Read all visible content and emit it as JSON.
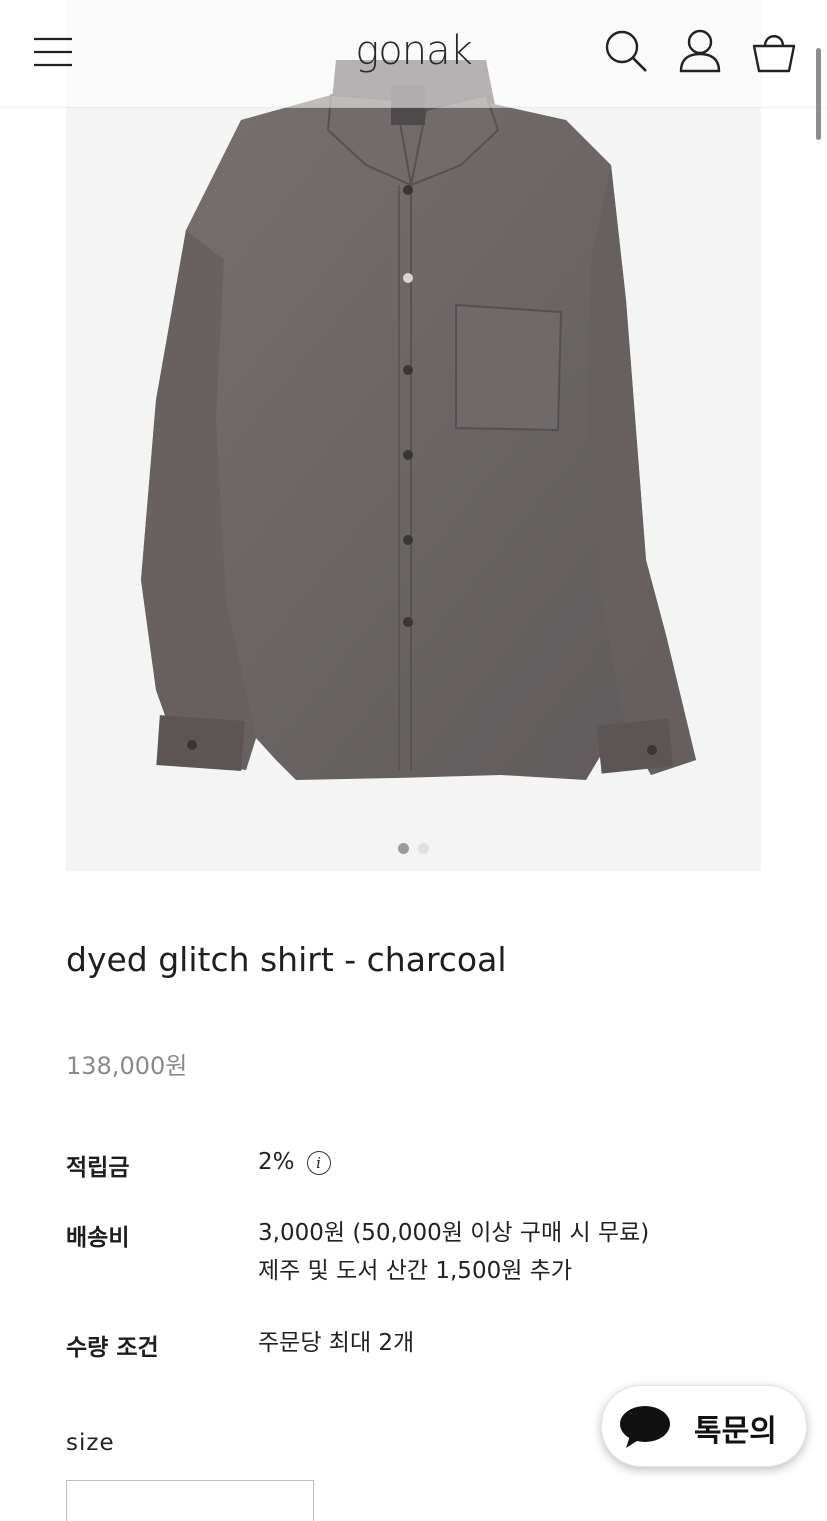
{
  "header": {
    "logo": "gonak",
    "icons": [
      "menu-icon",
      "search-icon",
      "user-icon",
      "cart-icon"
    ]
  },
  "gallery": {
    "slide_count": 2,
    "active_slide": 1,
    "background": "#f4f4f4"
  },
  "product": {
    "title": "dyed glitch shirt - charcoal",
    "price": "138,000원",
    "shirt_color": "#6b6566"
  },
  "details": {
    "points": {
      "label": "적립금",
      "value": "2%"
    },
    "shipping": {
      "label": "배송비",
      "value_line1": "3,000원 (50,000원 이상 구매 시 무료)",
      "value_line2": "제주 및 도서 산간 1,500원 추가"
    },
    "quantity": {
      "label": "수량 조건",
      "value": "주문당 최대 2개"
    }
  },
  "options": {
    "size_label": "size"
  },
  "chat": {
    "label": "톡문의"
  }
}
